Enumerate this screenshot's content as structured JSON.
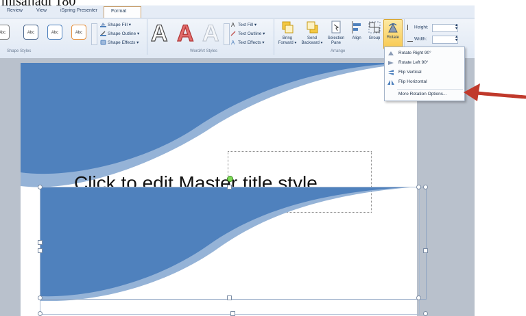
{
  "caption": "misaljadi 180",
  "tabs": [
    {
      "label": "Review"
    },
    {
      "label": "View"
    },
    {
      "label": "iSpring Presenter"
    },
    {
      "label": "Format"
    }
  ],
  "shape_styles": {
    "thumbs": [
      "Abc",
      "Abc",
      "Abc",
      "Abc"
    ],
    "shape_fill": "Shape Fill ▾",
    "shape_outline": "Shape Outline ▾",
    "shape_effects": "Shape Effects ▾",
    "group_label": "Shape Styles"
  },
  "wordart": {
    "text_fill": "Text Fill ▾",
    "text_outline": "Text Outline ▾",
    "text_effects": "Text Effects ▾",
    "group_label": "WordArt Styles"
  },
  "arrange": {
    "bring_forward": "Bring Forward ▾",
    "send_backward": "Send Backward ▾",
    "selection_pane": "Selection Pane",
    "align": "Align",
    "group": "Group",
    "rotate": "Rotate",
    "group_label": "Arrange"
  },
  "size": {
    "height_label": "Height:",
    "width_label": "Width:",
    "height_value": "",
    "width_value": ""
  },
  "rotate_menu": {
    "items": [
      {
        "label": "Rotate Right 90°",
        "icon": "rotate-right-icon"
      },
      {
        "label": "Rotate Left 90°",
        "icon": "rotate-left-icon"
      },
      {
        "label": "Flip Vertical",
        "icon": "flip-vertical-icon"
      },
      {
        "label": "Flip Horizontal",
        "icon": "flip-horizontal-icon"
      },
      {
        "label": "More Rotation Options...",
        "icon": ""
      }
    ]
  },
  "slide": {
    "title_placeholder": "Click to edit Master title style"
  },
  "colors": {
    "shape_blue": "#4f81bd",
    "shape_light": "#95b3d7",
    "arrow_red": "#c0392b",
    "rotate_highlight": "#fbd567"
  }
}
